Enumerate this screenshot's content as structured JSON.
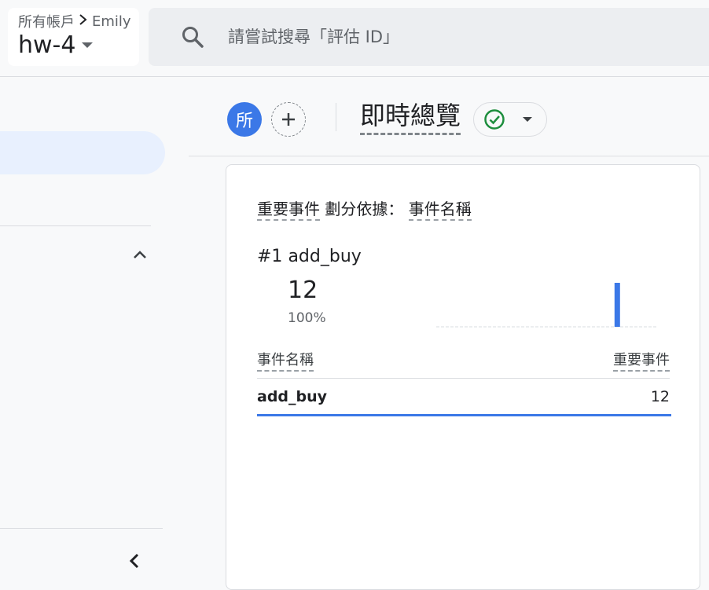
{
  "header": {
    "breadcrumb_root": "所有帳戶",
    "breadcrumb_account": "Emily",
    "property_name": "hw-4",
    "search_placeholder": "請嘗試搜尋「評估 ID」"
  },
  "report": {
    "avatar_letter": "所",
    "title": "即時總覽"
  },
  "card": {
    "metric_label": "重要事件",
    "split_label": "劃分依據：",
    "dimension_label": "事件名稱",
    "top_rank": "#1",
    "top_name": "add_buy",
    "top_value": "12",
    "top_percent": "100%",
    "column_left": "事件名稱",
    "column_right": "重要事件",
    "rows": [
      {
        "name": "add_buy",
        "value": "12",
        "share": 1.0
      }
    ]
  },
  "sparkline": {
    "values": [
      0,
      0,
      0,
      0,
      0,
      0,
      0,
      0,
      0,
      0,
      0,
      0,
      0,
      0,
      0,
      0,
      0,
      0,
      0,
      0,
      0,
      0,
      0,
      0,
      12,
      0,
      0,
      0,
      0,
      0
    ],
    "color": "#3b78e7"
  },
  "colors": {
    "accent": "#3b78e7",
    "success": "#1e8e3e"
  }
}
